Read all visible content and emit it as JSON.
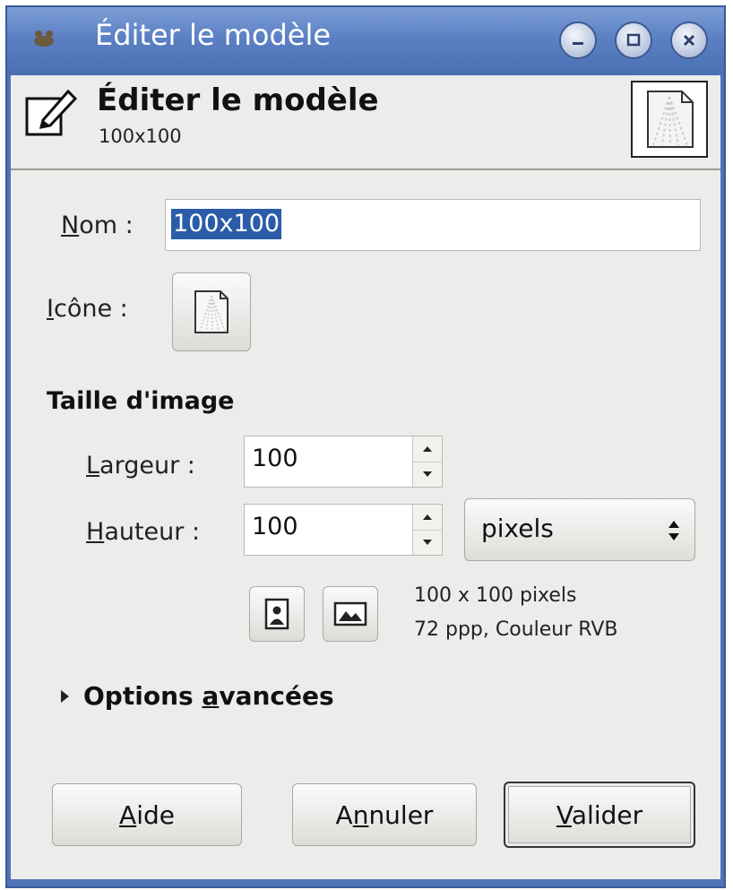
{
  "window": {
    "title": "Éditer le modèle",
    "controls": [
      "minimize-icon",
      "maximize-icon",
      "close-icon"
    ]
  },
  "header": {
    "title": "Éditer le modèle",
    "subtitle": "100x100"
  },
  "form": {
    "name_label_mnemonic": "N",
    "name_label_rest": "om :",
    "name_value": "100x100",
    "icon_label_mnemonic": "I",
    "icon_label_rest": "cône :"
  },
  "image_size": {
    "section_title": "Taille d'image",
    "width_label_mnemonic": "L",
    "width_label_rest": "argeur :",
    "width_value": "100",
    "height_label_mnemonic": "H",
    "height_label_rest": "auteur :",
    "height_value": "100",
    "unit": "pixels",
    "info_line1": "100 x 100 pixels",
    "info_line2": "72 ppp, Couleur RVB"
  },
  "advanced": {
    "label_before": "Options ",
    "label_mnemonic": "a",
    "label_after": "vancées",
    "expanded": false
  },
  "buttons": {
    "help_mnemonic": "A",
    "help_rest": "ide",
    "cancel_before": "A",
    "cancel_mnemonic": "n",
    "cancel_after": "nuler",
    "ok_mnemonic": "V",
    "ok_rest": "alider"
  },
  "colors": {
    "titlebar": "#5b80c3",
    "dialog_bg": "#ececea",
    "selection": "#2a5ca8"
  }
}
